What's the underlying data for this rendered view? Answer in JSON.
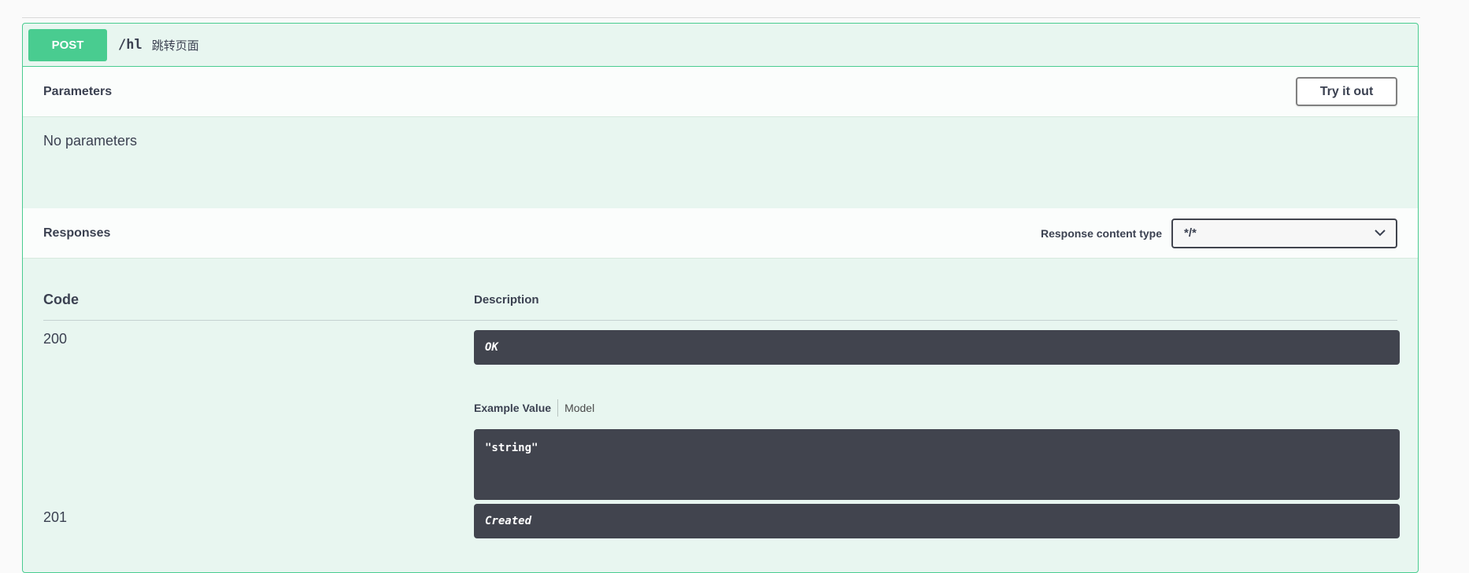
{
  "operation": {
    "method": "POST",
    "path": "/hl",
    "summary": "跳转页面",
    "colors": {
      "accent": "#49cc90",
      "background": "#e8f6f0",
      "dark_block": "#41444e"
    }
  },
  "parameters": {
    "title": "Parameters",
    "try_button": "Try it out",
    "empty_text": "No parameters"
  },
  "responses": {
    "title": "Responses",
    "content_type_label": "Response content type",
    "content_type_value": "*/*",
    "columns": {
      "code": "Code",
      "description": "Description"
    },
    "rows": [
      {
        "code": "200",
        "description": "OK",
        "tabs": [
          "Example Value",
          "Model"
        ],
        "example": "\"string\""
      },
      {
        "code": "201",
        "description": "Created"
      }
    ]
  },
  "icons": {
    "select_chevron": "chevron-down-icon"
  }
}
